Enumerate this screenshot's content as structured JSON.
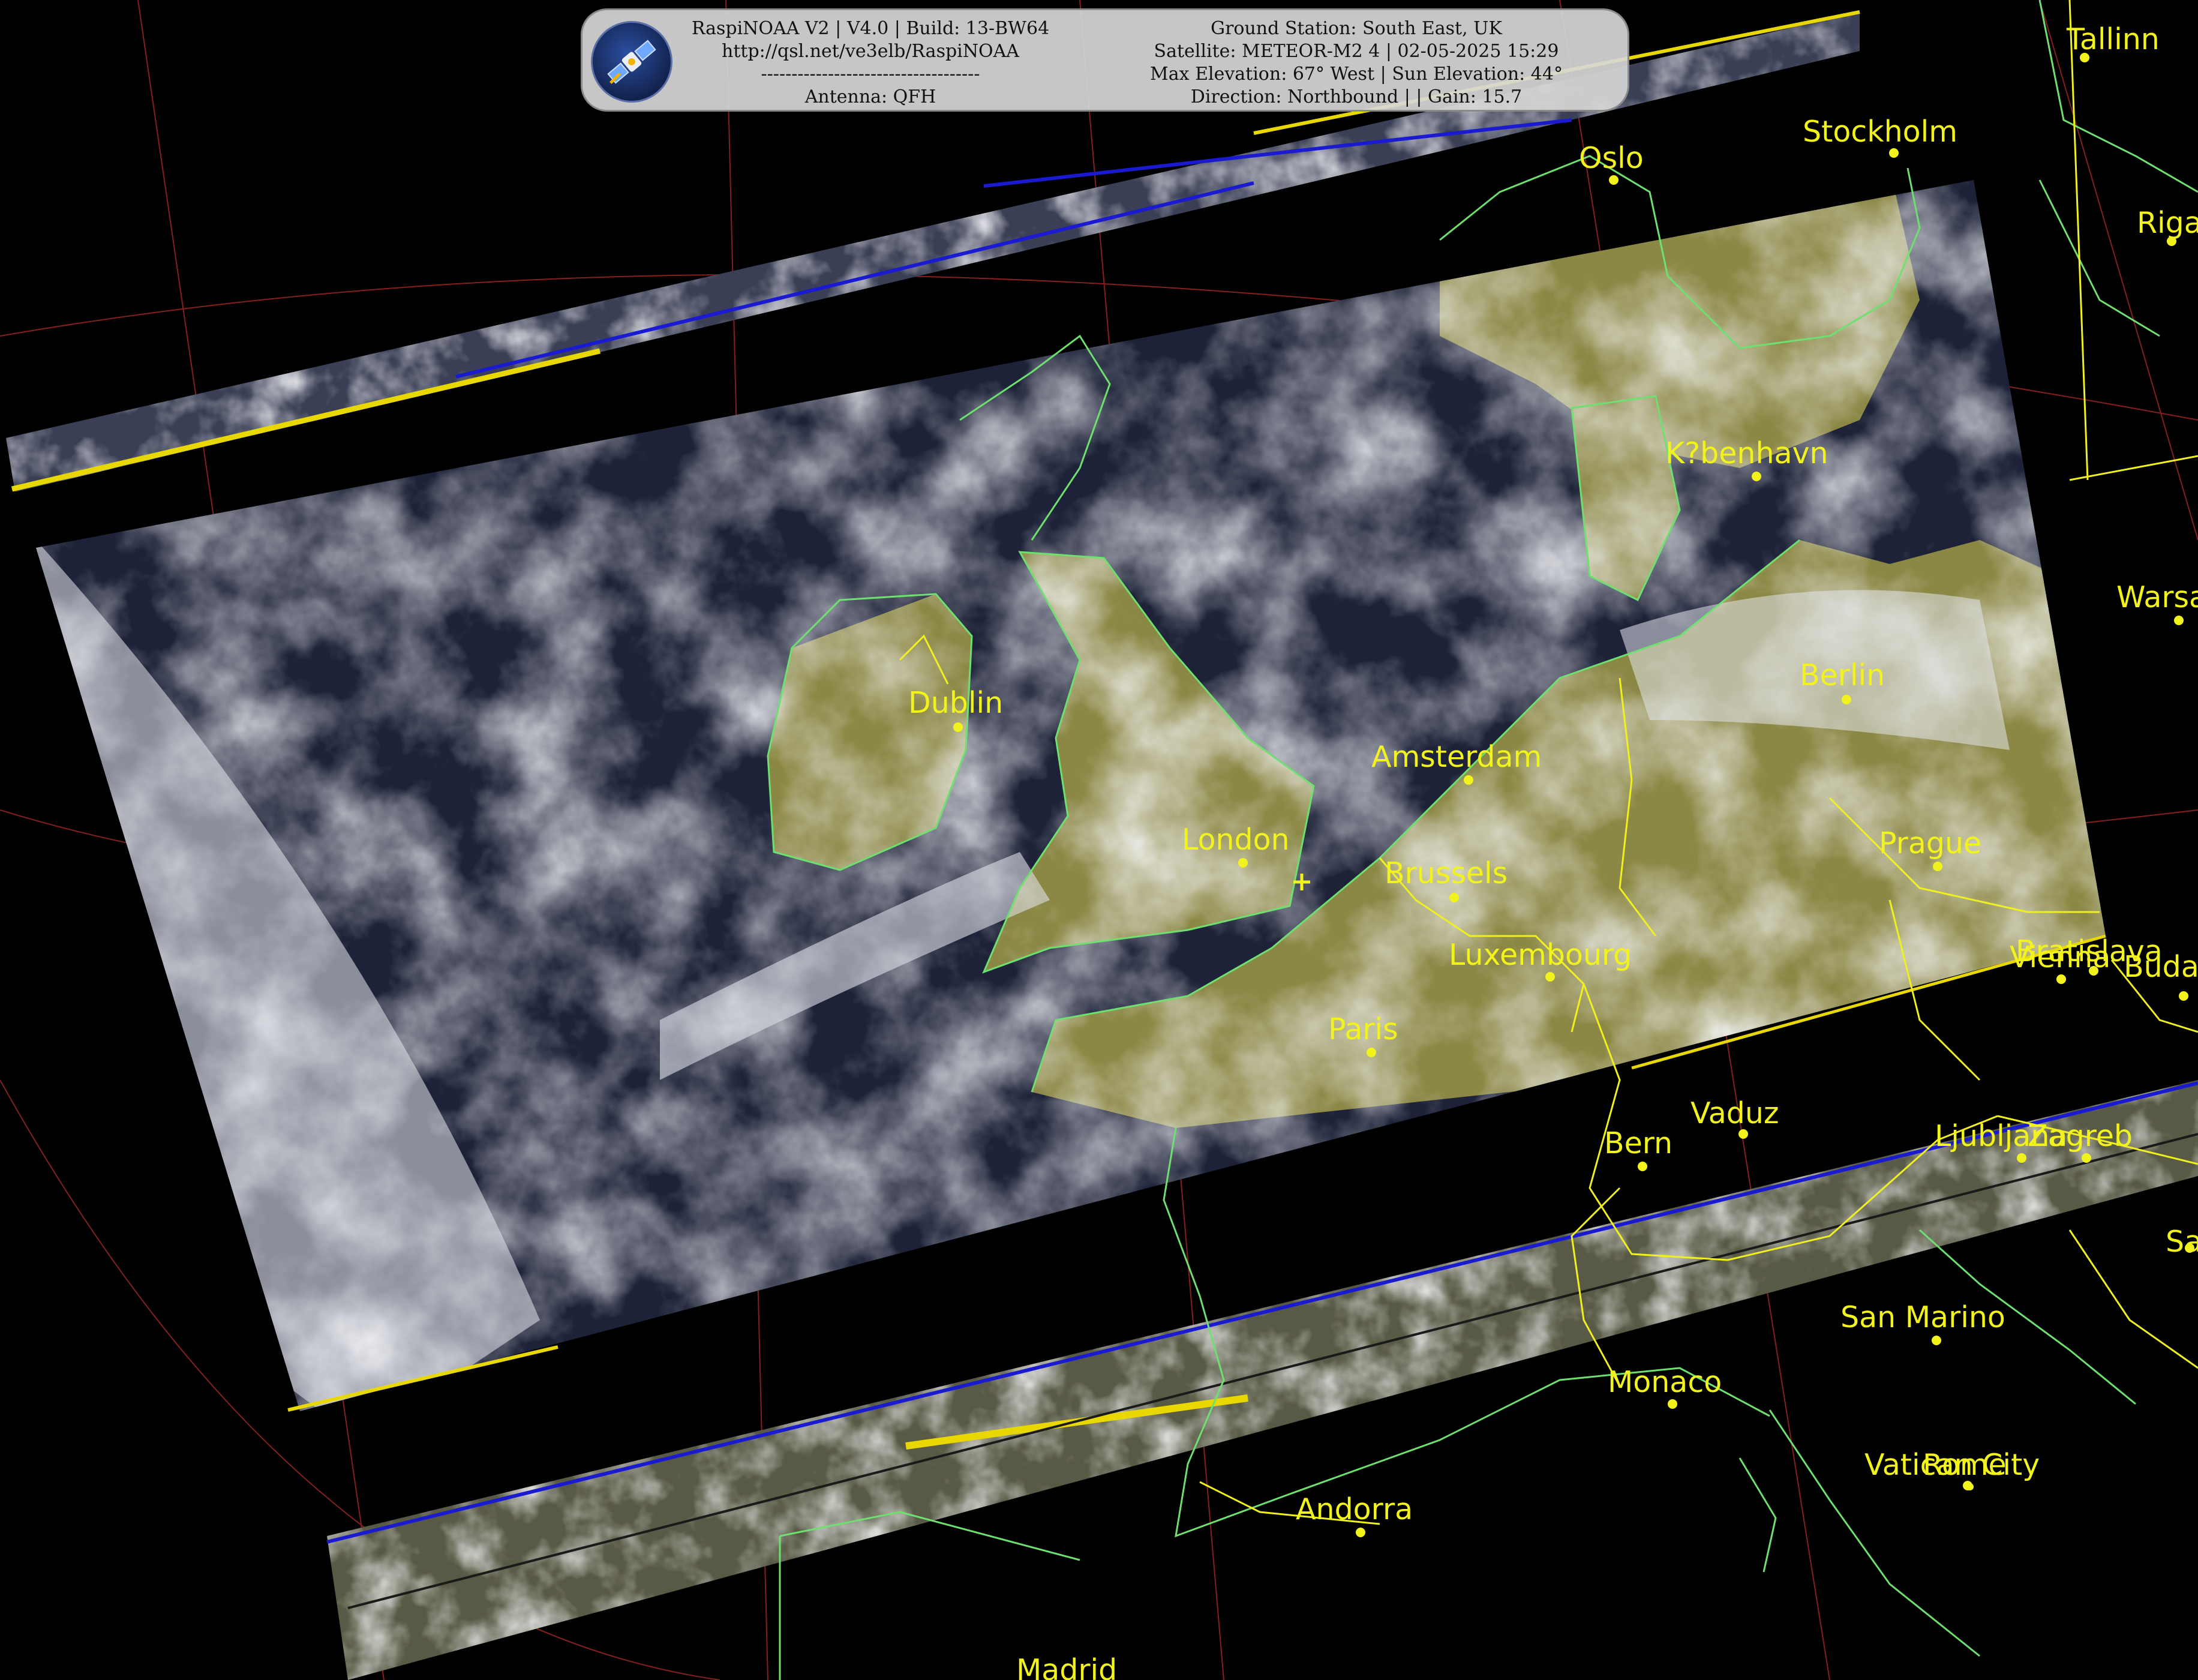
{
  "overlay": {
    "line1": "RaspiNOAA V2 | V4.0 | Build: 13-BW64",
    "line2": "http://qsl.net/ve3elb/RaspiNOAA",
    "line3": "------------------------------------",
    "line4": "Antenna: QFH",
    "station": "Ground Station: South East, UK",
    "satellite": "Satellite: METEOR-M2 4 | 02-05-2025 15:29",
    "elevation": "Max Elevation: 67° West | Sun Elevation: 44°",
    "direction": "Direction: Northbound | | Gain: 15.7"
  },
  "logo_icon": "satellite-icon",
  "colors": {
    "cloud": "#e6e8ee",
    "land": "#8c8845",
    "sea": "#1c2138",
    "coastline": "#6ee070",
    "borders": "#f0f020",
    "graticule": "#b02a2a",
    "city": "#f2f21c",
    "scan_blue": "#1a1ad0",
    "scan_yellow": "#f0e000"
  },
  "cities": [
    {
      "name": "Tallinn"
    },
    {
      "name": "Stockholm"
    },
    {
      "name": "Oslo"
    },
    {
      "name": "Riga"
    },
    {
      "name": "K?benhavn"
    },
    {
      "name": "Warsaw"
    },
    {
      "name": "Berlin"
    },
    {
      "name": "Dublin"
    },
    {
      "name": "Amsterdam"
    },
    {
      "name": "London"
    },
    {
      "name": "Brussels"
    },
    {
      "name": "Prague"
    },
    {
      "name": "Luxembourg"
    },
    {
      "name": "Vienna"
    },
    {
      "name": "Bratislava"
    },
    {
      "name": "Budapest"
    },
    {
      "name": "Paris"
    },
    {
      "name": "Vaduz"
    },
    {
      "name": "Bern"
    },
    {
      "name": "Ljubljana"
    },
    {
      "name": "Zagreb"
    },
    {
      "name": "Sarajevo"
    },
    {
      "name": "San Marino"
    },
    {
      "name": "Monaco"
    },
    {
      "name": "Vatican City"
    },
    {
      "name": "Rome"
    },
    {
      "name": "Andorra"
    },
    {
      "name": "Madrid"
    }
  ]
}
